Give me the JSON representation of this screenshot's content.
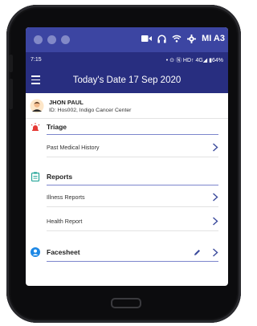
{
  "topbar": {
    "device_label": "MI A3",
    "bg": "#3c45a2",
    "icons": [
      "video-icon",
      "headphones-icon",
      "wifi-icon",
      "gear-icon"
    ]
  },
  "status": {
    "time": "7:15",
    "right": "• ⊙ Ⓝ HD↑ 4G◢ ▮64%"
  },
  "appbar": {
    "title": "Today's Date 17 Sep 2020",
    "bg": "#282e80"
  },
  "patient": {
    "name": "JHON PAUL",
    "id_line": "ID: Hos002,  Indigo Cancer Center"
  },
  "sections": {
    "triage": {
      "label": "Triage",
      "items": [
        "Past Medical History"
      ]
    },
    "reports": {
      "label": "Reports",
      "items": [
        "Illness Reports",
        "Health Report"
      ]
    },
    "facesheet": {
      "label": "Facesheet"
    }
  },
  "colors": {
    "accent": "#7c86cc",
    "triage_icon": "#e53935",
    "reports_icon": "#26a69a",
    "facesheet_icon": "#1e88e5"
  }
}
